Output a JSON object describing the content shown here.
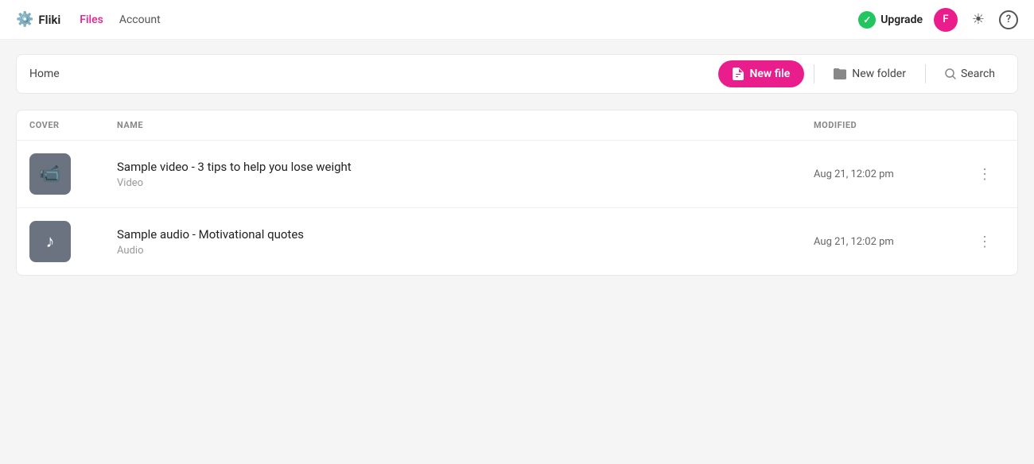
{
  "navbar": {
    "brand": "Fliki",
    "nav_links": [
      {
        "label": "Files",
        "active": true
      },
      {
        "label": "Account",
        "active": false
      }
    ],
    "upgrade_label": "Upgrade",
    "avatar_letter": "F",
    "help_label": "?"
  },
  "toolbar": {
    "breadcrumb": "Home",
    "new_file_label": "New file",
    "new_folder_label": "New folder",
    "search_label": "Search"
  },
  "table": {
    "columns": [
      {
        "label": "COVER",
        "key": "cover"
      },
      {
        "label": "NAME",
        "key": "name"
      },
      {
        "label": "MODIFIED",
        "key": "modified"
      },
      {
        "label": "",
        "key": "actions"
      }
    ],
    "rows": [
      {
        "id": 1,
        "cover_type": "video",
        "name": "Sample video - 3 tips to help you lose weight",
        "type": "Video",
        "modified": "Aug 21, 12:02 pm"
      },
      {
        "id": 2,
        "cover_type": "audio",
        "name": "Sample audio - Motivational quotes",
        "type": "Audio",
        "modified": "Aug 21, 12:02 pm"
      }
    ]
  },
  "colors": {
    "brand_pink": "#e91e8c",
    "brand_green": "#22c55e",
    "cover_gray": "#6b7280"
  }
}
